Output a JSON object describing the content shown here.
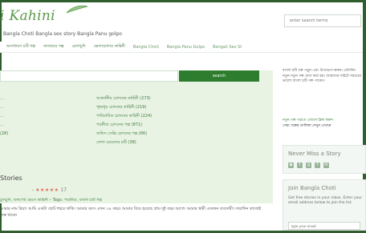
{
  "header": {
    "logo_text": "i Kahini",
    "tagline": "Bangla Choti Bangla sex story Bangla Panu golpo",
    "search_placeholder": "enter search terms"
  },
  "nav": {
    "items": [
      "অসাধারণ চটি গল্প",
      "অজাচার গল্প",
      "চোদাচুদি",
      "ভোদাচোদার কাহিনী",
      "Bangla Choti",
      "Bangla Panu Golpo",
      "Bengali Sex St"
    ]
  },
  "main": {
    "search_placeholder": "",
    "search_button": "search",
    "categories": [
      "আকর্ষনীয় চোদনের কাহিনী (273)",
      "গৃহবধূর চোদনের কাহিনী (219)",
      "পারিবারিক চোদনের কাহিনী (224)",
      "পরকীয়া চোদনের গল্প (871)",
      "অফিস সেক্সি চোদনের গল্প (66)",
      "বেশ্যা মেয়েদের চটি (38)"
    ],
    "left_categories": [
      "…",
      "…",
      "…",
      "…",
      "(28)"
    ],
    "stories_title": "Stories",
    "rating": {
      "dash": "-",
      "stars": "★★★★★",
      "pct": "17"
    },
    "tags_line": "চুদাচুদি, তলপেট ভেসে কাহিনী – Tags: পরকীয়া, বাংলা চটি গল্প",
    "excerpt": "আমার নাম রিয়া। আমি একটা ছোট শহরে থাকি। আমার বয়স এখন ২৪ বছর। আমার বিয়ে হয়েছে প্রায় দুই বছর আগে। আমার স্বামী একজন ব্যবসায়ী। সারাদিন কাজেই ব্যস্ত থাকে।"
  },
  "sidebar": {
    "text": "বাংলা চটি গল্প পড়ুন এবং উপভোগ করুন। প্রতিদিন নতুন নতুন গল্প যোগ করা হয়। আমাদের সাইটে সবচেয়ে ভালো বাংলা চটি গল্প পাবেন।",
    "link_line_1": "নতুন গল্প পড়তে এখানে ক্লিক করুন",
    "link_line_2": "সেরা গল্পের তালিকা দেখুন এখানে",
    "newsletter_title": "Never Miss a Story",
    "social_icons": [
      "rss-icon",
      "twitter-icon",
      "google-plus-icon",
      "facebook-icon",
      "email-icon"
    ],
    "join_title": "Join Bangla Choti",
    "join_desc": "Get free stories in your inbox. Enter your email address below to join the list.",
    "email_placeholder": "type your email"
  }
}
